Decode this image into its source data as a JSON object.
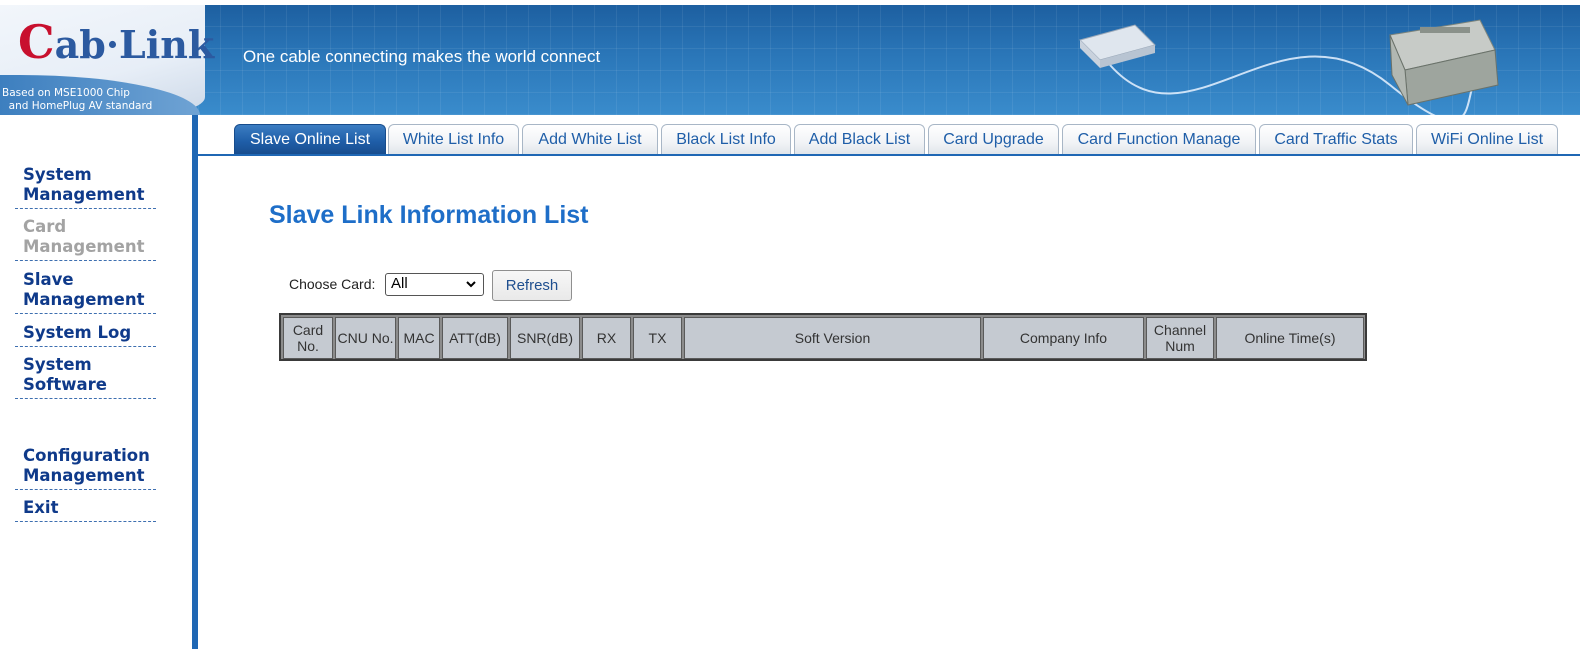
{
  "header": {
    "logo_c": "C",
    "logo_rest": "ab·Link",
    "logo_sub": "Based on MSE1000 Chip\n  and HomePlug AV standard",
    "slogan": "One cable connecting makes the world connect"
  },
  "sidebar": {
    "items": [
      {
        "label": "System Management",
        "enabled": true
      },
      {
        "label": "Card Management",
        "enabled": false
      },
      {
        "label": "Slave Management",
        "enabled": true
      },
      {
        "label": "System Log",
        "enabled": true
      },
      {
        "label": "System Software",
        "enabled": true
      },
      {
        "label": "Configuration Management",
        "enabled": true
      },
      {
        "label": "Exit",
        "enabled": true
      }
    ]
  },
  "tabs": [
    {
      "label": "Slave Online List",
      "active": true
    },
    {
      "label": "White List Info",
      "active": false
    },
    {
      "label": "Add White List",
      "active": false
    },
    {
      "label": "Black List Info",
      "active": false
    },
    {
      "label": "Add Black List",
      "active": false
    },
    {
      "label": "Card Upgrade",
      "active": false
    },
    {
      "label": "Card Function Manage",
      "active": false
    },
    {
      "label": "Card Traffic Stats",
      "active": false
    },
    {
      "label": "WiFi Online List",
      "active": false
    }
  ],
  "main": {
    "title": "Slave Link Information List",
    "choose_label": "Choose Card:",
    "card_select_value": "All",
    "refresh_label": "Refresh",
    "table": {
      "columns": [
        "Card No.",
        "CNU No.",
        "MAC",
        "ATT(dB)",
        "SNR(dB)",
        "RX",
        "TX",
        "Soft Version",
        "Company Info",
        "Channel Num",
        "Online Time(s)"
      ],
      "rows": []
    }
  },
  "colors": {
    "accent": "#1f67b4",
    "nav_text": "#0f3a8a",
    "title": "#1e6ec8",
    "logo_red": "#c8102e"
  }
}
